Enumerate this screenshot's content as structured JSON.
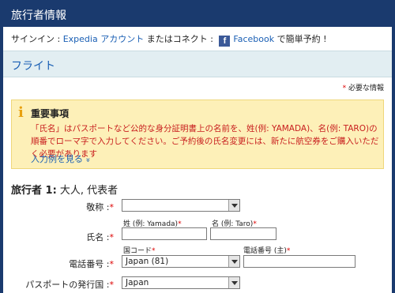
{
  "header": {
    "title": "旅行者情報"
  },
  "signin": {
    "prefix": "サインイン : ",
    "expedia_link": "Expedia アカウント",
    "middle": " またはコネクト : ",
    "fb_glyph": "f",
    "facebook_link": "Facebook",
    "suffix": " で簡単予約 !"
  },
  "section": {
    "title": "フライト"
  },
  "required_note": {
    "asterisk": "*",
    "text": " 必要な情報"
  },
  "notice": {
    "title": "重要事項",
    "body": "「氏名」はパスポートなど公的な身分証明書上の名前を、姓(例: YAMADA)、名(例: TARO)の順番でローマ字で入力してください。ご予約後の氏名変更には、新たに航空券をご購入いただく必要があります",
    "link": "入力例を見る",
    "link_chevron": "»"
  },
  "traveler": {
    "label": "旅行者 1:",
    "detail": " 大人, 代表者"
  },
  "form": {
    "asterisk": "*",
    "title_label": "敬称 :",
    "title_value": "",
    "name_label": "氏名 :",
    "last_name_hint": "姓 (例: Yamada)",
    "first_name_hint": "名 (例: Taro)",
    "phone_label": "電話番号 :",
    "country_code_hint": "国コード",
    "phone_number_hint": "電話番号 (主)",
    "country_code_value": "Japan (81)",
    "passport_label": "パスポートの発行国 :",
    "passport_value": "Japan"
  }
}
